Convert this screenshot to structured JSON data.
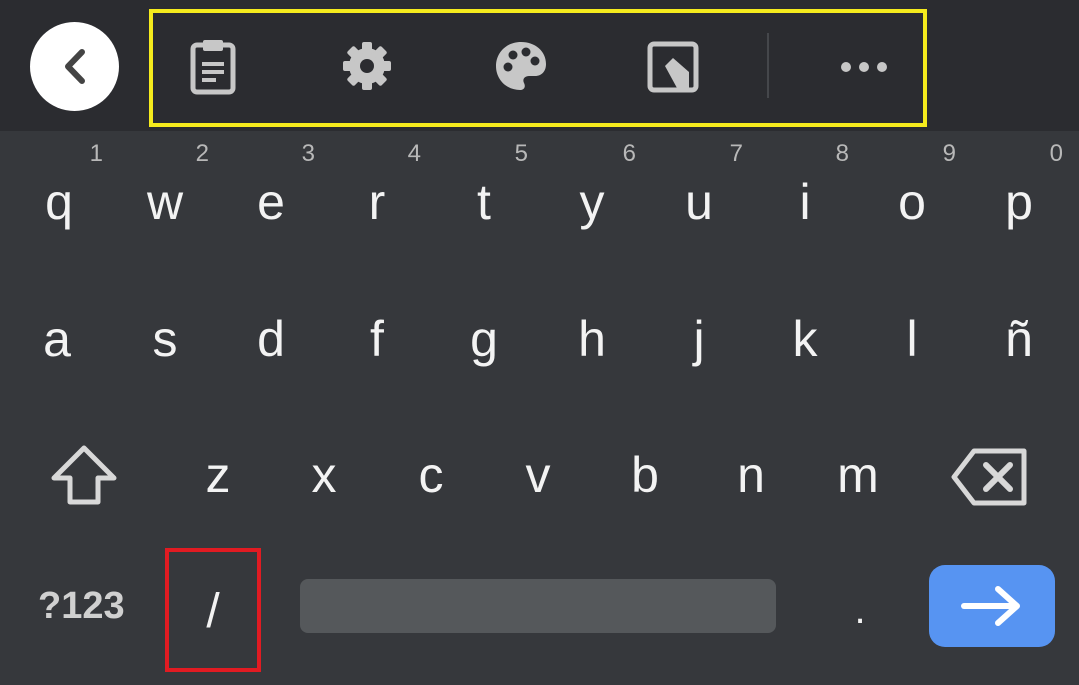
{
  "toolbar": {
    "back_icon": "chevron-left-icon",
    "icons": [
      "clipboard-icon",
      "gear-icon",
      "palette-icon",
      "one-handed-icon",
      "more-icon"
    ]
  },
  "keyboard": {
    "row1": [
      {
        "letter": "q",
        "hint": "1"
      },
      {
        "letter": "w",
        "hint": "2"
      },
      {
        "letter": "e",
        "hint": "3"
      },
      {
        "letter": "r",
        "hint": "4"
      },
      {
        "letter": "t",
        "hint": "5"
      },
      {
        "letter": "y",
        "hint": "6"
      },
      {
        "letter": "u",
        "hint": "7"
      },
      {
        "letter": "i",
        "hint": "8"
      },
      {
        "letter": "o",
        "hint": "9"
      },
      {
        "letter": "p",
        "hint": "0"
      }
    ],
    "row2": [
      "a",
      "s",
      "d",
      "f",
      "g",
      "h",
      "j",
      "k",
      "l",
      "ñ"
    ],
    "row3": [
      "z",
      "x",
      "c",
      "v",
      "b",
      "n",
      "m"
    ],
    "bottom": {
      "symbols_label": "?123",
      "slash_label": "/",
      "period_label": "."
    }
  },
  "colors": {
    "background": "#36383c",
    "toolbar": "#2b2c30",
    "accent": "#5794f2",
    "highlight_yellow": "#f5eb1d",
    "highlight_red": "#e11b22"
  }
}
